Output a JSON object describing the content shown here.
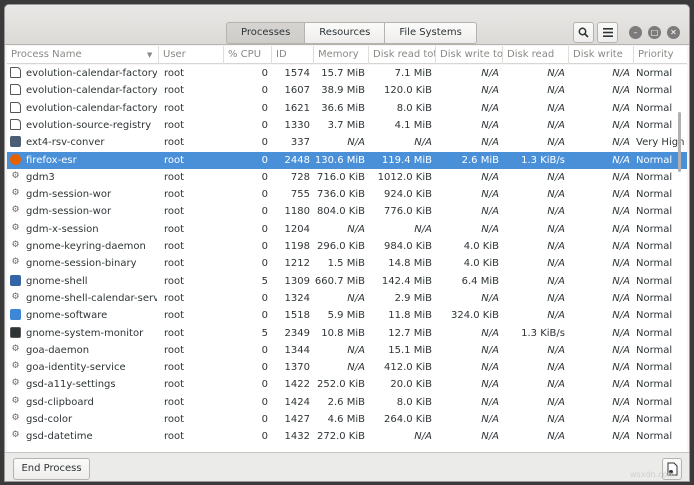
{
  "tabs": [
    "Processes",
    "Resources",
    "File Systems"
  ],
  "active_tab": 0,
  "header_icons": {
    "search": "search-icon",
    "menu": "hamburger-menu-icon",
    "minimize": "minimize-icon",
    "maximize": "maximize-icon",
    "close": "close-icon"
  },
  "columns": [
    "Process Name",
    "User",
    "% CPU",
    "ID",
    "Memory",
    "Disk read tota",
    "Disk write tot",
    "Disk read",
    "Disk write",
    "Priority"
  ],
  "rows": [
    {
      "name": "evolution-calendar-factory",
      "icon": "page",
      "user": "root",
      "cpu": "0",
      "id": "1574",
      "mem": "15.7 MiB",
      "drt": "7.1 MiB",
      "dwt": "N/A",
      "dr": "N/A",
      "dw": "N/A",
      "prio": "Normal"
    },
    {
      "name": "evolution-calendar-factory-subp",
      "icon": "page",
      "user": "root",
      "cpu": "0",
      "id": "1607",
      "mem": "38.9 MiB",
      "drt": "120.0 KiB",
      "dwt": "N/A",
      "dr": "N/A",
      "dw": "N/A",
      "prio": "Normal"
    },
    {
      "name": "evolution-calendar-factory-subp",
      "icon": "page",
      "user": "root",
      "cpu": "0",
      "id": "1621",
      "mem": "36.6 MiB",
      "drt": "8.0 KiB",
      "dwt": "N/A",
      "dr": "N/A",
      "dw": "N/A",
      "prio": "Normal"
    },
    {
      "name": "evolution-source-registry",
      "icon": "page",
      "user": "root",
      "cpu": "0",
      "id": "1330",
      "mem": "3.7 MiB",
      "drt": "4.1 MiB",
      "dwt": "N/A",
      "dr": "N/A",
      "dw": "N/A",
      "prio": "Normal"
    },
    {
      "name": "ext4-rsv-conver",
      "icon": "disk",
      "user": "root",
      "cpu": "0",
      "id": "337",
      "mem": "N/A",
      "drt": "N/A",
      "dwt": "N/A",
      "dr": "N/A",
      "dw": "N/A",
      "prio": "Very High"
    },
    {
      "name": "firefox-esr",
      "icon": "ff",
      "user": "root",
      "cpu": "0",
      "id": "2448",
      "mem": "130.6 MiB",
      "drt": "119.4 MiB",
      "dwt": "2.6 MiB",
      "dr": "1.3 KiB/s",
      "dw": "N/A",
      "prio": "Normal",
      "selected": true
    },
    {
      "name": "gdm3",
      "icon": "gear",
      "user": "root",
      "cpu": "0",
      "id": "728",
      "mem": "716.0 KiB",
      "drt": "1012.0 KiB",
      "dwt": "N/A",
      "dr": "N/A",
      "dw": "N/A",
      "prio": "Normal"
    },
    {
      "name": "gdm-session-wor",
      "icon": "gear",
      "user": "root",
      "cpu": "0",
      "id": "755",
      "mem": "736.0 KiB",
      "drt": "924.0 KiB",
      "dwt": "N/A",
      "dr": "N/A",
      "dw": "N/A",
      "prio": "Normal"
    },
    {
      "name": "gdm-session-wor",
      "icon": "gear",
      "user": "root",
      "cpu": "0",
      "id": "1180",
      "mem": "804.0 KiB",
      "drt": "776.0 KiB",
      "dwt": "N/A",
      "dr": "N/A",
      "dw": "N/A",
      "prio": "Normal"
    },
    {
      "name": "gdm-x-session",
      "icon": "gear",
      "user": "root",
      "cpu": "0",
      "id": "1204",
      "mem": "N/A",
      "drt": "N/A",
      "dwt": "N/A",
      "dr": "N/A",
      "dw": "N/A",
      "prio": "Normal"
    },
    {
      "name": "gnome-keyring-daemon",
      "icon": "gear",
      "user": "root",
      "cpu": "0",
      "id": "1198",
      "mem": "296.0 KiB",
      "drt": "984.0 KiB",
      "dwt": "4.0 KiB",
      "dr": "N/A",
      "dw": "N/A",
      "prio": "Normal"
    },
    {
      "name": "gnome-session-binary",
      "icon": "gear",
      "user": "root",
      "cpu": "0",
      "id": "1212",
      "mem": "1.5 MiB",
      "drt": "14.8 MiB",
      "dwt": "4.0 KiB",
      "dr": "N/A",
      "dw": "N/A",
      "prio": "Normal"
    },
    {
      "name": "gnome-shell",
      "icon": "shell",
      "user": "root",
      "cpu": "5",
      "id": "1309",
      "mem": "660.7 MiB",
      "drt": "142.4 MiB",
      "dwt": "6.4 MiB",
      "dr": "N/A",
      "dw": "N/A",
      "prio": "Normal"
    },
    {
      "name": "gnome-shell-calendar-server",
      "icon": "gear",
      "user": "root",
      "cpu": "0",
      "id": "1324",
      "mem": "N/A",
      "drt": "2.9 MiB",
      "dwt": "N/A",
      "dr": "N/A",
      "dw": "N/A",
      "prio": "Normal"
    },
    {
      "name": "gnome-software",
      "icon": "sw",
      "user": "root",
      "cpu": "0",
      "id": "1518",
      "mem": "5.9 MiB",
      "drt": "11.8 MiB",
      "dwt": "324.0 KiB",
      "dr": "N/A",
      "dw": "N/A",
      "prio": "Normal"
    },
    {
      "name": "gnome-system-monitor",
      "icon": "mon",
      "user": "root",
      "cpu": "5",
      "id": "2349",
      "mem": "10.8 MiB",
      "drt": "12.7 MiB",
      "dwt": "N/A",
      "dr": "1.3 KiB/s",
      "dw": "N/A",
      "prio": "Normal"
    },
    {
      "name": "goa-daemon",
      "icon": "gear",
      "user": "root",
      "cpu": "0",
      "id": "1344",
      "mem": "N/A",
      "drt": "15.1 MiB",
      "dwt": "N/A",
      "dr": "N/A",
      "dw": "N/A",
      "prio": "Normal"
    },
    {
      "name": "goa-identity-service",
      "icon": "gear",
      "user": "root",
      "cpu": "0",
      "id": "1370",
      "mem": "N/A",
      "drt": "412.0 KiB",
      "dwt": "N/A",
      "dr": "N/A",
      "dw": "N/A",
      "prio": "Normal"
    },
    {
      "name": "gsd-a11y-settings",
      "icon": "gear",
      "user": "root",
      "cpu": "0",
      "id": "1422",
      "mem": "252.0 KiB",
      "drt": "20.0 KiB",
      "dwt": "N/A",
      "dr": "N/A",
      "dw": "N/A",
      "prio": "Normal"
    },
    {
      "name": "gsd-clipboard",
      "icon": "gear",
      "user": "root",
      "cpu": "0",
      "id": "1424",
      "mem": "2.6 MiB",
      "drt": "8.0 KiB",
      "dwt": "N/A",
      "dr": "N/A",
      "dw": "N/A",
      "prio": "Normal"
    },
    {
      "name": "gsd-color",
      "icon": "gear",
      "user": "root",
      "cpu": "0",
      "id": "1427",
      "mem": "4.6 MiB",
      "drt": "264.0 KiB",
      "dwt": "N/A",
      "dr": "N/A",
      "dw": "N/A",
      "prio": "Normal"
    },
    {
      "name": "gsd-datetime",
      "icon": "gear",
      "user": "root",
      "cpu": "0",
      "id": "1432",
      "mem": "272.0 KiB",
      "drt": "N/A",
      "dwt": "N/A",
      "dr": "N/A",
      "dw": "N/A",
      "prio": "Normal"
    }
  ],
  "footer": {
    "end_process": "End Process",
    "properties_icon": "document-properties-icon"
  },
  "watermark": "wsxdn.com",
  "colors": {
    "selection": "#4a90d9",
    "header_bg": "#dcdad7"
  }
}
